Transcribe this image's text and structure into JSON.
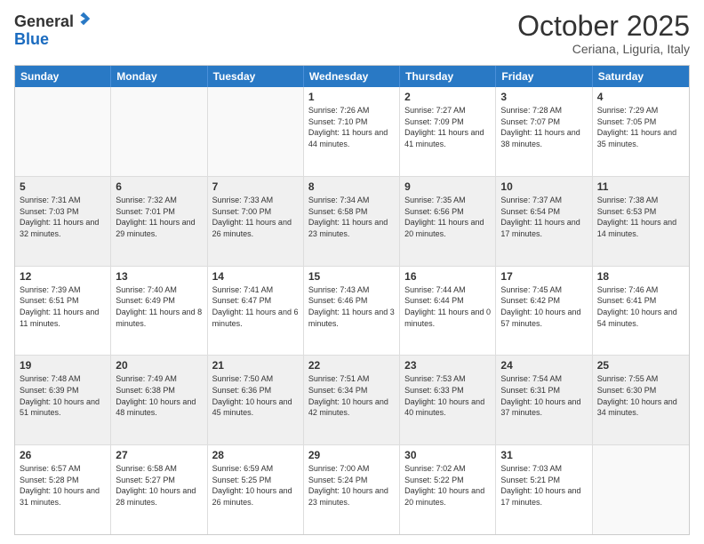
{
  "logo": {
    "general": "General",
    "blue": "Blue"
  },
  "title": "October 2025",
  "location": "Ceriana, Liguria, Italy",
  "days": [
    "Sunday",
    "Monday",
    "Tuesday",
    "Wednesday",
    "Thursday",
    "Friday",
    "Saturday"
  ],
  "rows": [
    [
      {
        "day": "",
        "info": ""
      },
      {
        "day": "",
        "info": ""
      },
      {
        "day": "",
        "info": ""
      },
      {
        "day": "1",
        "info": "Sunrise: 7:26 AM\nSunset: 7:10 PM\nDaylight: 11 hours and 44 minutes."
      },
      {
        "day": "2",
        "info": "Sunrise: 7:27 AM\nSunset: 7:09 PM\nDaylight: 11 hours and 41 minutes."
      },
      {
        "day": "3",
        "info": "Sunrise: 7:28 AM\nSunset: 7:07 PM\nDaylight: 11 hours and 38 minutes."
      },
      {
        "day": "4",
        "info": "Sunrise: 7:29 AM\nSunset: 7:05 PM\nDaylight: 11 hours and 35 minutes."
      }
    ],
    [
      {
        "day": "5",
        "info": "Sunrise: 7:31 AM\nSunset: 7:03 PM\nDaylight: 11 hours and 32 minutes."
      },
      {
        "day": "6",
        "info": "Sunrise: 7:32 AM\nSunset: 7:01 PM\nDaylight: 11 hours and 29 minutes."
      },
      {
        "day": "7",
        "info": "Sunrise: 7:33 AM\nSunset: 7:00 PM\nDaylight: 11 hours and 26 minutes."
      },
      {
        "day": "8",
        "info": "Sunrise: 7:34 AM\nSunset: 6:58 PM\nDaylight: 11 hours and 23 minutes."
      },
      {
        "day": "9",
        "info": "Sunrise: 7:35 AM\nSunset: 6:56 PM\nDaylight: 11 hours and 20 minutes."
      },
      {
        "day": "10",
        "info": "Sunrise: 7:37 AM\nSunset: 6:54 PM\nDaylight: 11 hours and 17 minutes."
      },
      {
        "day": "11",
        "info": "Sunrise: 7:38 AM\nSunset: 6:53 PM\nDaylight: 11 hours and 14 minutes."
      }
    ],
    [
      {
        "day": "12",
        "info": "Sunrise: 7:39 AM\nSunset: 6:51 PM\nDaylight: 11 hours and 11 minutes."
      },
      {
        "day": "13",
        "info": "Sunrise: 7:40 AM\nSunset: 6:49 PM\nDaylight: 11 hours and 8 minutes."
      },
      {
        "day": "14",
        "info": "Sunrise: 7:41 AM\nSunset: 6:47 PM\nDaylight: 11 hours and 6 minutes."
      },
      {
        "day": "15",
        "info": "Sunrise: 7:43 AM\nSunset: 6:46 PM\nDaylight: 11 hours and 3 minutes."
      },
      {
        "day": "16",
        "info": "Sunrise: 7:44 AM\nSunset: 6:44 PM\nDaylight: 11 hours and 0 minutes."
      },
      {
        "day": "17",
        "info": "Sunrise: 7:45 AM\nSunset: 6:42 PM\nDaylight: 10 hours and 57 minutes."
      },
      {
        "day": "18",
        "info": "Sunrise: 7:46 AM\nSunset: 6:41 PM\nDaylight: 10 hours and 54 minutes."
      }
    ],
    [
      {
        "day": "19",
        "info": "Sunrise: 7:48 AM\nSunset: 6:39 PM\nDaylight: 10 hours and 51 minutes."
      },
      {
        "day": "20",
        "info": "Sunrise: 7:49 AM\nSunset: 6:38 PM\nDaylight: 10 hours and 48 minutes."
      },
      {
        "day": "21",
        "info": "Sunrise: 7:50 AM\nSunset: 6:36 PM\nDaylight: 10 hours and 45 minutes."
      },
      {
        "day": "22",
        "info": "Sunrise: 7:51 AM\nSunset: 6:34 PM\nDaylight: 10 hours and 42 minutes."
      },
      {
        "day": "23",
        "info": "Sunrise: 7:53 AM\nSunset: 6:33 PM\nDaylight: 10 hours and 40 minutes."
      },
      {
        "day": "24",
        "info": "Sunrise: 7:54 AM\nSunset: 6:31 PM\nDaylight: 10 hours and 37 minutes."
      },
      {
        "day": "25",
        "info": "Sunrise: 7:55 AM\nSunset: 6:30 PM\nDaylight: 10 hours and 34 minutes."
      }
    ],
    [
      {
        "day": "26",
        "info": "Sunrise: 6:57 AM\nSunset: 5:28 PM\nDaylight: 10 hours and 31 minutes."
      },
      {
        "day": "27",
        "info": "Sunrise: 6:58 AM\nSunset: 5:27 PM\nDaylight: 10 hours and 28 minutes."
      },
      {
        "day": "28",
        "info": "Sunrise: 6:59 AM\nSunset: 5:25 PM\nDaylight: 10 hours and 26 minutes."
      },
      {
        "day": "29",
        "info": "Sunrise: 7:00 AM\nSunset: 5:24 PM\nDaylight: 10 hours and 23 minutes."
      },
      {
        "day": "30",
        "info": "Sunrise: 7:02 AM\nSunset: 5:22 PM\nDaylight: 10 hours and 20 minutes."
      },
      {
        "day": "31",
        "info": "Sunrise: 7:03 AM\nSunset: 5:21 PM\nDaylight: 10 hours and 17 minutes."
      },
      {
        "day": "",
        "info": ""
      }
    ]
  ]
}
